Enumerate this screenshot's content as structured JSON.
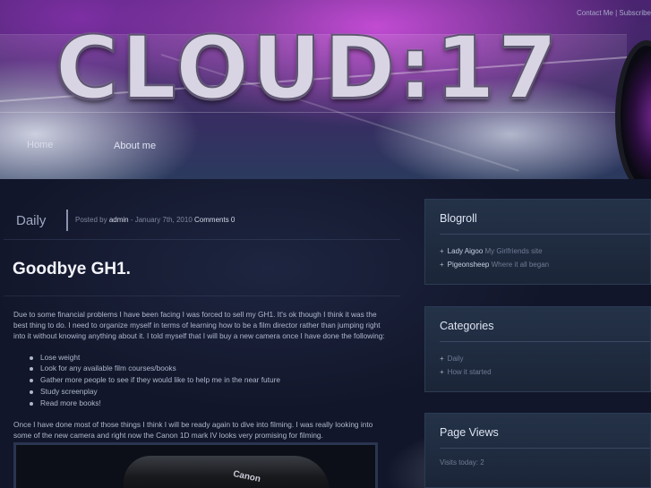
{
  "header": {
    "logo": "CLOUD:17",
    "top_links": {
      "contact": "Contact Me",
      "separator": "|",
      "subscribe": "Subscribe"
    },
    "nav": {
      "home": "Home",
      "about": "About me"
    }
  },
  "post": {
    "category": "Daily",
    "meta": {
      "posted_by_label": "Posted by",
      "author": "admin",
      "date": "- January 7th, 2010",
      "comments": "Comments 0"
    },
    "title": "Goodbye GH1.",
    "paragraph_1": "Due to some financial problems I have been facing I was forced to sell my GH1. It's ok though I think it was the best thing to do. I need to organize myself in terms of learning how to be a film director rather than jumping right into it without knowing anything about it. I told myself that I will buy a new camera once I have done the following:",
    "list": [
      "Lose weight",
      "Look for any available film courses/books",
      "Gather more people to see if they would like to help me in the near future",
      "Study screenplay",
      "Read more books!"
    ],
    "paragraph_2": "Once I have done most of those things I think I will be ready again to dive into filming. I was really looking into some of the new camera and right now the Canon 1D mark IV looks very promising for filming.",
    "image_label": "Canon"
  },
  "sidebar": {
    "blogroll": {
      "title": "Blogroll",
      "items": [
        {
          "link": "Lady Aigoo",
          "desc": "My Girlfriends site"
        },
        {
          "link": "Pigeonsheep",
          "desc": "Where it all began"
        }
      ]
    },
    "categories": {
      "title": "Categories",
      "items": [
        "Daily",
        "How it started"
      ]
    },
    "page_views": {
      "title": "Page Views",
      "text": "Visits today: 2"
    }
  }
}
